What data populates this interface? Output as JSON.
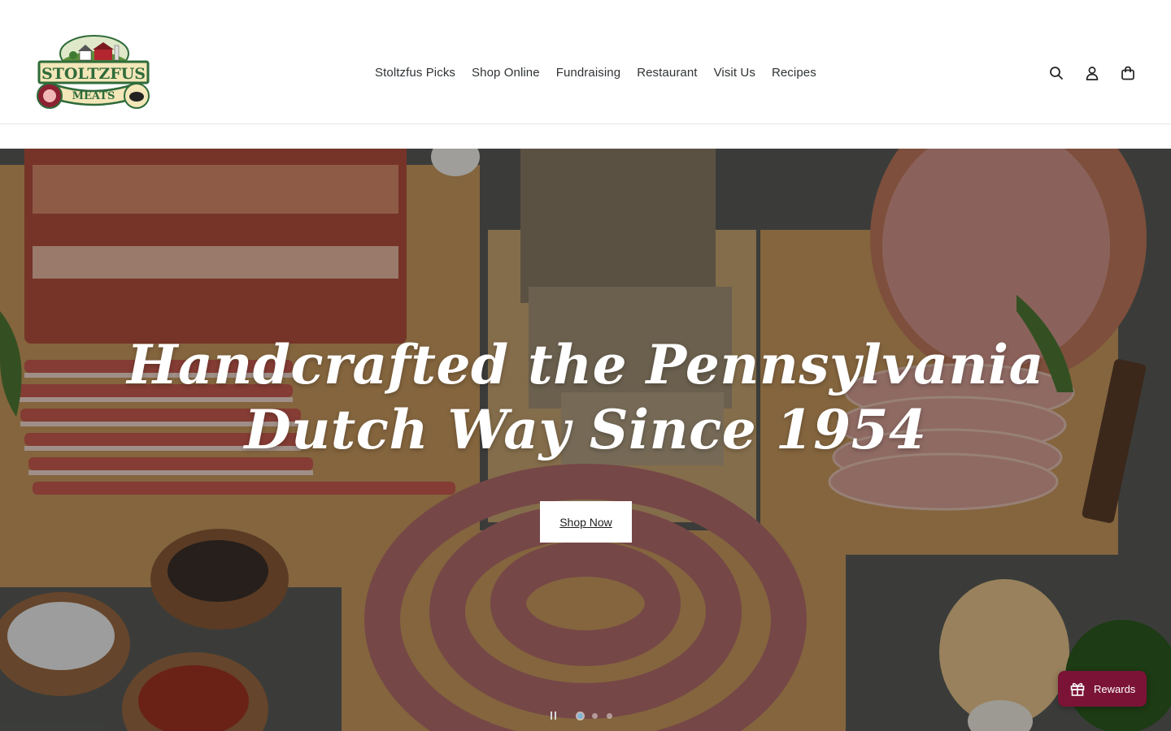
{
  "brand": {
    "logo_line1": "STOLTZFUS",
    "logo_line2": "MEATS"
  },
  "nav": {
    "items": [
      {
        "label": "Stoltzfus Picks"
      },
      {
        "label": "Shop Online"
      },
      {
        "label": "Fundraising"
      },
      {
        "label": "Restaurant"
      },
      {
        "label": "Visit Us"
      },
      {
        "label": "Recipes"
      }
    ]
  },
  "header_icons": [
    "search-icon",
    "account-icon",
    "cart-icon"
  ],
  "hero": {
    "title_line1": "Handcrafted the Pennsylvania",
    "title_line2": "Dutch Way Since 1954",
    "cta_label": "Shop Now",
    "slides_total": 3,
    "active_slide": 1
  },
  "rewards": {
    "label": "Rewards",
    "color": "#7a1336"
  },
  "colors": {
    "logo_green": "#2f6b3a",
    "logo_cream": "#f3e6b8",
    "logo_red": "#8c2132"
  }
}
